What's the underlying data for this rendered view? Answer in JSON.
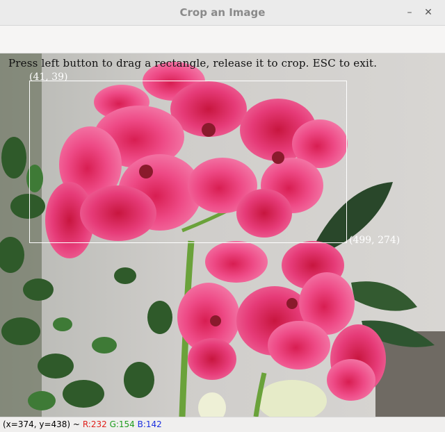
{
  "window": {
    "title": "Crop an Image",
    "minimize_icon": "minimize-icon",
    "close_icon": "close-icon"
  },
  "image_view": {
    "instruction": "Press left button to drag a rectangle, release it to crop. ESC to exit.",
    "start_label": "(41, 39)",
    "end_label": "(499, 274)",
    "selection_color": "#ffffff"
  },
  "status": {
    "position": "(x=374, y=438) ~",
    "r": "R:232",
    "g": "G:154",
    "b": "B:142",
    "r_color": "#e0201b",
    "g_color": "#1c9c1c",
    "b_color": "#1a2fe0"
  }
}
